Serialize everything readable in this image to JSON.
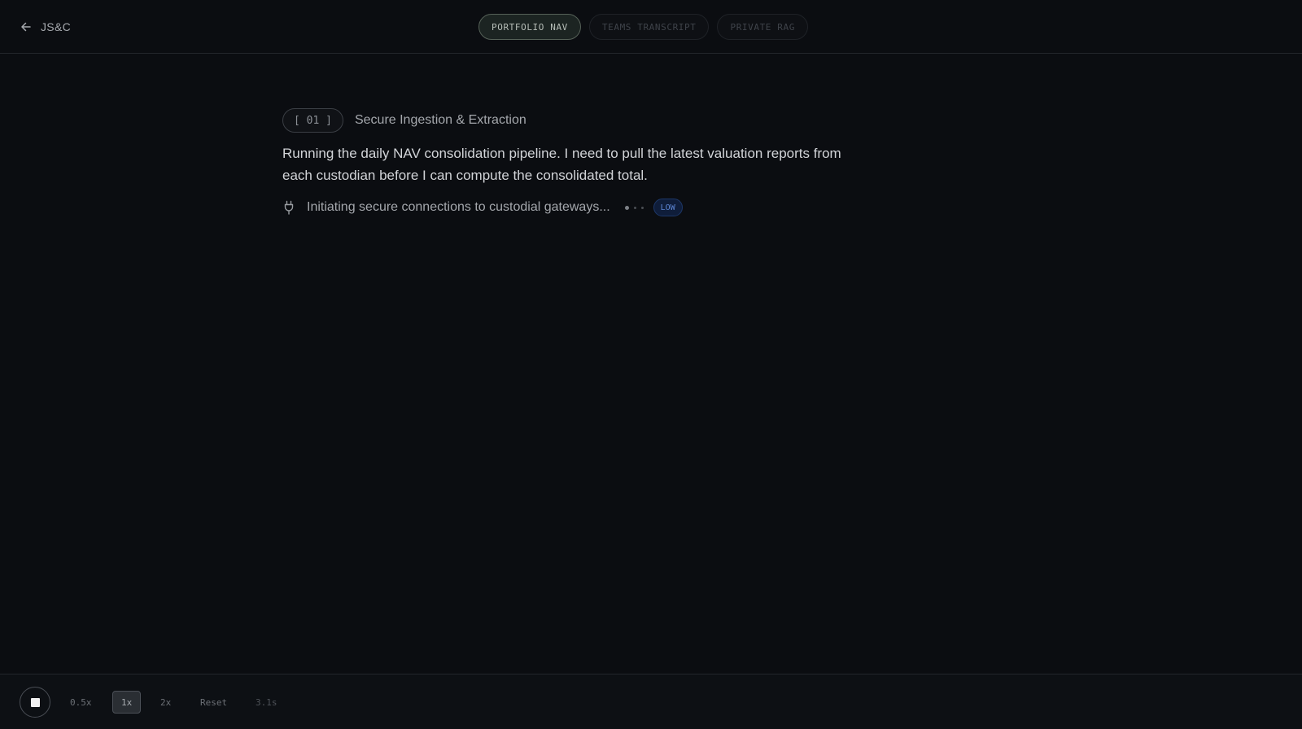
{
  "header": {
    "brand": "JS&C",
    "tabs": [
      {
        "label": "PORTFOLIO NAV",
        "active": true
      },
      {
        "label": "TEAMS TRANSCRIPT",
        "active": false
      },
      {
        "label": "PRIVATE RAG",
        "active": false
      }
    ]
  },
  "step": {
    "badge": "[ 01 ]",
    "title": "Secure Ingestion & Extraction",
    "message": "Running the daily NAV consolidation pipeline. I need to pull the latest valuation reports from each custodian before I can compute the consolidated total.",
    "status": {
      "icon": "plug-icon",
      "text": "Initiating secure connections to custodial gateways...",
      "priority": "LOW"
    }
  },
  "footer": {
    "stop_icon": "stop-icon",
    "speeds": [
      "0.5x",
      "1x",
      "2x"
    ],
    "active_speed": "1x",
    "reset_label": "Reset",
    "elapsed": "3.1s"
  },
  "colors": {
    "background": "#0b0d11",
    "active_tab_border": "#566158",
    "priority_badge": "#5d86d4"
  }
}
